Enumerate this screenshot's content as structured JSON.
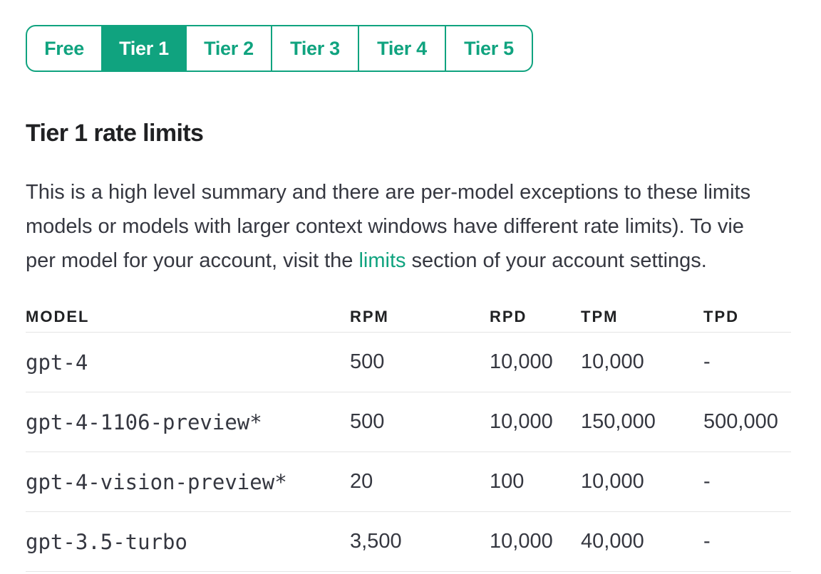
{
  "tabs": [
    {
      "label": "Free",
      "active": false
    },
    {
      "label": "Tier 1",
      "active": true
    },
    {
      "label": "Tier 2",
      "active": false
    },
    {
      "label": "Tier 3",
      "active": false
    },
    {
      "label": "Tier 4",
      "active": false
    },
    {
      "label": "Tier 5",
      "active": false
    }
  ],
  "heading": "Tier 1 rate limits",
  "summary": {
    "line1": "This is a high level summary and there are per-model exceptions to these limits",
    "line2": "models or models with larger context windows have different rate limits). To vie",
    "line3_before": "per model for your account, visit the ",
    "link_text": "limits",
    "line3_after": " section of your account settings."
  },
  "table": {
    "headers": {
      "model": "MODEL",
      "rpm": "RPM",
      "rpd": "RPD",
      "tpm": "TPM",
      "tpd": "TPD"
    },
    "rows": [
      {
        "model": "gpt-4",
        "rpm": "500",
        "rpd": "10,000",
        "tpm": "10,000",
        "tpd": "-"
      },
      {
        "model": "gpt-4-1106-preview*",
        "rpm": "500",
        "rpd": "10,000",
        "tpm": "150,000",
        "tpd": "500,000"
      },
      {
        "model": "gpt-4-vision-preview*",
        "rpm": "20",
        "rpd": "100",
        "tpm": "10,000",
        "tpd": "-"
      },
      {
        "model": "gpt-3.5-turbo",
        "rpm": "3,500",
        "rpd": "10,000",
        "tpm": "40,000",
        "tpd": "-"
      }
    ]
  },
  "colors": {
    "accent": "#10a37f",
    "text": "#202123",
    "body_text": "#353740",
    "divider": "#e5e5e5"
  }
}
